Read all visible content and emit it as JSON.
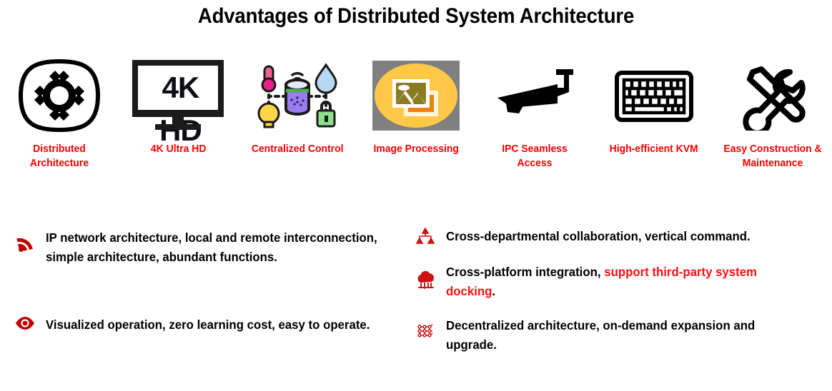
{
  "page": {
    "title": "Advantages of Distributed System Architecture",
    "background": "#ffffff",
    "label_color": "#ff0000",
    "bullet_icon_color": "#c00000",
    "highlight_color": "#ff1111"
  },
  "features": [
    {
      "icon": "distributed-network-hub-icon",
      "label": "Distributed Architecture",
      "label_lines": [
        "Distributed",
        "Architecture"
      ]
    },
    {
      "icon": "monitor-4k-hd-icon",
      "icon_text": "4K HD",
      "label": "4K Ultra HD",
      "label_lines": [
        "4K Ultra HD"
      ]
    },
    {
      "icon": "smart-hub-sensors-icon",
      "label": "Centralized Control",
      "label_lines": [
        "Centralized",
        "Control"
      ]
    },
    {
      "icon": "photo-stack-icon",
      "label": "Image Processing",
      "label_lines": [
        "Image",
        "Processing"
      ]
    },
    {
      "icon": "cctv-camera-icon",
      "label": "IPC Seamless Access",
      "label_lines": [
        "IPC Seamless",
        "Access"
      ]
    },
    {
      "icon": "keyboard-icon",
      "label": "High-efficient KVM",
      "label_lines": [
        "High-efficient",
        "KVM"
      ]
    },
    {
      "icon": "wrench-screwdriver-icon",
      "label": "Easy Construction & Maintenance",
      "label_lines": [
        "Easy Construction &",
        "Maintenance"
      ]
    }
  ],
  "bullets": {
    "left": [
      {
        "icon": "rss-signal-icon",
        "lines": [
          "IP network architecture, local and remote",
          "interconnection, simple architecture, abundant functions."
        ],
        "text": "IP network architecture, local and remote interconnection, simple architecture, abundant functions."
      },
      {
        "icon": "eye-icon",
        "lines": [
          "Visualized operation, zero learning cost, easy to operate."
        ],
        "text": "Visualized operation, zero learning cost, easy to operate."
      }
    ],
    "right": [
      {
        "icon": "org-chart-hierarchy-icon",
        "lines": [
          "Cross-departmental collaboration, vertical command."
        ],
        "text": "Cross-departmental collaboration, vertical command."
      },
      {
        "icon": "cloud-icon",
        "text_plain_1": "Cross-platform integration, ",
        "text_highlight": "support third-party system docking",
        "text_plain_2": ".",
        "text": "Cross-platform integration, support third-party system docking."
      },
      {
        "icon": "mesh-grid-icon",
        "lines": [
          "Decentralized architecture, on-demand expansion and",
          "upgrade."
        ],
        "text": "Decentralized architecture, on-demand expansion and upgrade."
      }
    ]
  }
}
